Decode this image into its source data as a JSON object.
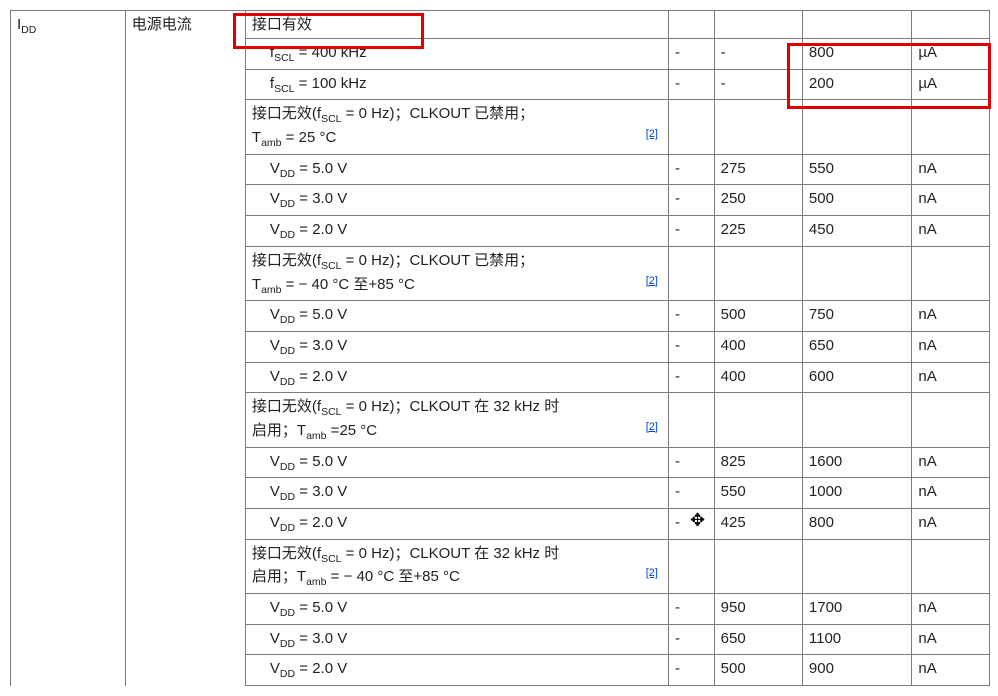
{
  "symbol_html": "I<span class='sub'>DD</span>",
  "param": "电源电流",
  "ref": "[2]",
  "rows": [
    {
      "type": "section",
      "label": "接口有效"
    },
    {
      "type": "data",
      "cond_html": "<span class='indent'>f<span class='sub'>SCL</span> = 400 kHz</span>",
      "c1": "-",
      "c2": "-",
      "c3": "800",
      "u": "µA"
    },
    {
      "type": "data",
      "cond_html": "<span class='indent'>f<span class='sub'>SCL</span> = 100 kHz</span>",
      "c1": "-",
      "c2": "-",
      "c3": "200",
      "u": "µA"
    },
    {
      "type": "section_ref",
      "label_html": "接口无效(f<span class='sub'>SCL</span> = 0 Hz)；CLKOUT 已禁用；<br>T<span class='sub'>amb</span> = 25 °C"
    },
    {
      "type": "data",
      "cond_html": "<span class='indent'>V<span class='sub'>DD</span> = 5.0 V</span>",
      "c1": "-",
      "c2": "275",
      "c3": "550",
      "u": "nA"
    },
    {
      "type": "data",
      "cond_html": "<span class='indent'>V<span class='sub'>DD</span> = 3.0 V</span>",
      "c1": "-",
      "c2": "250",
      "c3": "500",
      "u": "nA"
    },
    {
      "type": "data",
      "cond_html": "<span class='indent'>V<span class='sub'>DD</span> = 2.0 V</span>",
      "c1": "-",
      "c2": "225",
      "c3": "450",
      "u": "nA"
    },
    {
      "type": "section_ref",
      "label_html": "接口无效(f<span class='sub'>SCL</span> = 0 Hz)；CLKOUT 已禁用；<br>T<span class='sub'>amb</span> = − 40 °C 至+85 °C"
    },
    {
      "type": "data",
      "cond_html": "<span class='indent'>V<span class='sub'>DD</span> = 5.0 V</span>",
      "c1": "-",
      "c2": "500",
      "c3": "750",
      "u": "nA"
    },
    {
      "type": "data",
      "cond_html": "<span class='indent'>V<span class='sub'>DD</span> = 3.0 V</span>",
      "c1": "-",
      "c2": "400",
      "c3": "650",
      "u": "nA"
    },
    {
      "type": "data",
      "cond_html": "<span class='indent'>V<span class='sub'>DD</span> = 2.0 V</span>",
      "c1": "-",
      "c2": "400",
      "c3": "600",
      "u": "nA"
    },
    {
      "type": "section_ref",
      "label_html": "接口无效(f<span class='sub'>SCL</span> = 0 Hz)；CLKOUT 在 32 kHz 时<br>启用；T<span class='sub'>amb</span> =25 °C"
    },
    {
      "type": "data",
      "cond_html": "<span class='indent'>V<span class='sub'>DD</span> = 5.0 V</span>",
      "c1": "-",
      "c2": "825",
      "c3": "1600",
      "u": "nA"
    },
    {
      "type": "data",
      "cond_html": "<span class='indent'>V<span class='sub'>DD</span> = 3.0 V</span>",
      "c1": "-",
      "c2": "550",
      "c3": "1000",
      "u": "nA"
    },
    {
      "type": "data",
      "cond_html": "<span class='indent'>V<span class='sub'>DD</span> = 2.0 V</span>",
      "c1": "-",
      "c2": "425",
      "c3": "800",
      "u": "nA"
    },
    {
      "type": "section_ref",
      "label_html": "接口无效(f<span class='sub'>SCL</span> = 0 Hz)；CLKOUT 在 32 kHz 时<br>启用；T<span class='sub'>amb</span> = − 40 °C 至+85 °C"
    },
    {
      "type": "data",
      "cond_html": "<span class='indent'>V<span class='sub'>DD</span> = 5.0 V</span>",
      "c1": "-",
      "c2": "950",
      "c3": "1700",
      "u": "nA"
    },
    {
      "type": "data",
      "cond_html": "<span class='indent'>V<span class='sub'>DD</span> = 3.0 V</span>",
      "c1": "-",
      "c2": "650",
      "c3": "1100",
      "u": "nA"
    },
    {
      "type": "data",
      "cond_html": "<span class='indent'>V<span class='sub'>DD</span> = 2.0 V</span>",
      "c1": "-",
      "c2": "500",
      "c3": "900",
      "u": "nA"
    }
  ]
}
